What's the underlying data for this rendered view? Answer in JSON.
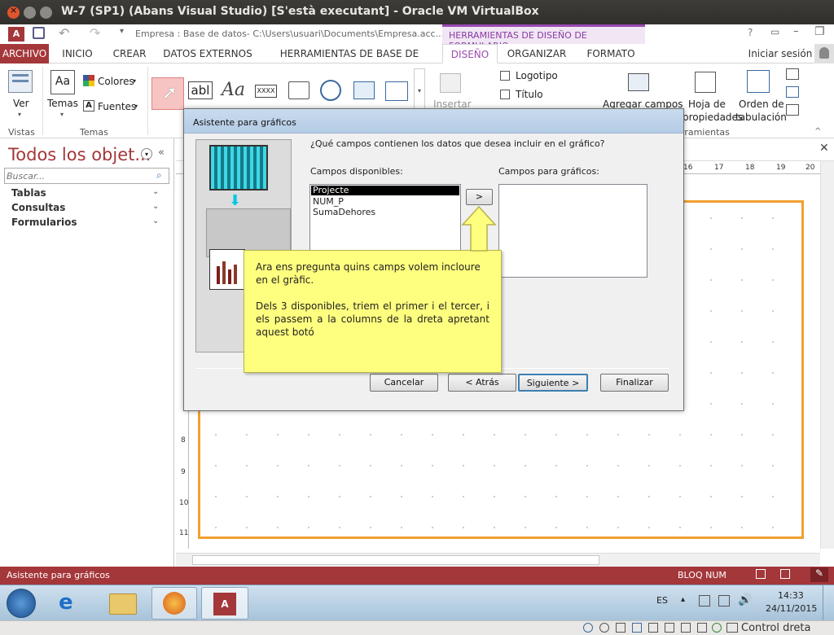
{
  "window": {
    "title": "W-7 (SP1) (Abans Visual Studio) [S'està executant] - Oracle VM VirtualBox"
  },
  "qat": {
    "path": "Empresa : Base de datos- C:\\Users\\usuari\\Documents\\Empresa.acc...",
    "context_title": "HERRAMIENTAS DE DISEÑO DE FORMULARIO",
    "help": "?"
  },
  "tabs": [
    "ARCHIVO",
    "INICIO",
    "CREAR",
    "DATOS EXTERNOS",
    "HERRAMIENTAS DE BASE DE DATOS",
    "DISEÑO",
    "ORGANIZAR",
    "FORMATO"
  ],
  "signin": "Iniciar sesión",
  "ribbon": {
    "ver": "Ver",
    "temas": "Temas",
    "colores": "Colores",
    "fuentes": "Fuentes",
    "text_control": "abl",
    "label_control": "Aa",
    "xxxx": "XXXX",
    "insertar": "Insertar",
    "logotipo": "Logotipo",
    "titulo": "Título",
    "agregar": "Agregar campos",
    "hoja1": "Hoja de",
    "hoja2": "propiedades",
    "orden1": "Orden de",
    "orden2": "tabulación",
    "grp_vistas": "Vistas",
    "grp_temas": "Temas",
    "grp_herr": "rramientas"
  },
  "nav": {
    "title": "Todos los objet...",
    "search_placeholder": "Buscar...",
    "groups": [
      "Tablas",
      "Consultas",
      "Formularios"
    ]
  },
  "ruler": {
    "top": [
      "16",
      "17",
      "18",
      "19",
      "20"
    ],
    "left": [
      "8",
      "9",
      "10",
      "11"
    ]
  },
  "dialog": {
    "title": "Asistente para gráficos",
    "question": "¿Qué campos contienen los datos que desea incluir en el gráfico?",
    "available_label": "Campos disponibles:",
    "chart_label": "Campos para gráficos:",
    "available": [
      "Projecte",
      "NUM_P",
      "SumaDehores"
    ],
    "move_one": ">",
    "buttons": {
      "cancel": "Cancelar",
      "back": "< Atrás",
      "next": "Siguiente >",
      "finish": "Finalizar"
    }
  },
  "callout": {
    "p1": "Ara ens pregunta quins camps volem incloure en el gràfic.",
    "p2": "Dels 3 disponibles, triem el primer i el tercer, i els passem a la columns de la dreta apretant aquest botó"
  },
  "status": {
    "left": "Asistente para gráficos",
    "bloq": "BLOQ NUM"
  },
  "taskbar": {
    "lang": "ES",
    "time": "14:33",
    "date": "24/11/2015"
  },
  "vbox": {
    "host_key": "Control dreta"
  },
  "colors": {
    "accent": "#a4373a",
    "callout": "#ffff7f",
    "orange_border": "#f0a030"
  }
}
